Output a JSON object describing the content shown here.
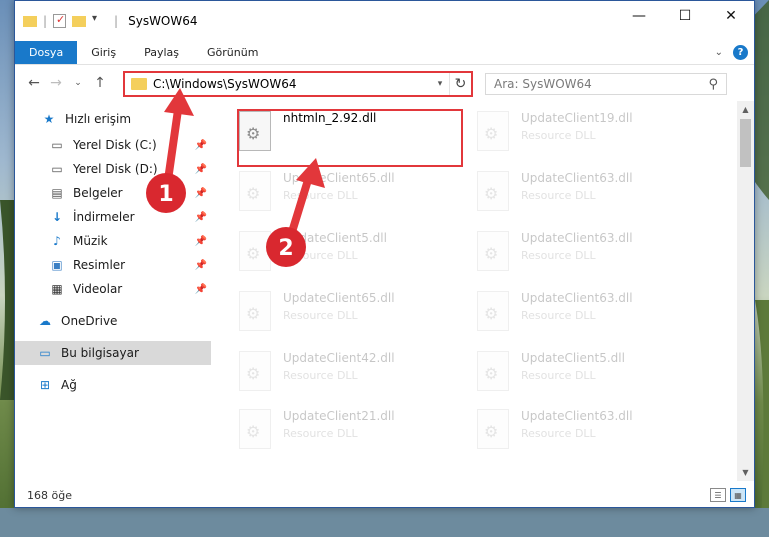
{
  "window": {
    "title": "SysWOW64"
  },
  "ribbon": {
    "tabs": [
      "Dosya",
      "Giriş",
      "Paylaş",
      "Görünüm"
    ]
  },
  "address": {
    "path": "C:\\Windows\\SysWOW64"
  },
  "search": {
    "placeholder": "Ara: SysWOW64"
  },
  "sidebar": {
    "items": [
      {
        "label": "Hızlı erişim",
        "icon": "star-icon",
        "pinned": false
      },
      {
        "label": "Yerel Disk (C:)",
        "icon": "drive-icon",
        "pinned": true
      },
      {
        "label": "Yerel Disk (D:)",
        "icon": "drive-icon",
        "pinned": true
      },
      {
        "label": "Belgeler",
        "icon": "document-icon",
        "pinned": true
      },
      {
        "label": "İndirmeler",
        "icon": "download-icon",
        "pinned": true
      },
      {
        "label": "Müzik",
        "icon": "music-icon",
        "pinned": true
      },
      {
        "label": "Resimler",
        "icon": "picture-icon",
        "pinned": true
      },
      {
        "label": "Videolar",
        "icon": "video-icon",
        "pinned": true
      },
      {
        "label": "OneDrive",
        "icon": "cloud-icon",
        "pinned": false
      },
      {
        "label": "Bu bilgisayar",
        "icon": "computer-icon",
        "pinned": false
      },
      {
        "label": "Ağ",
        "icon": "network-icon",
        "pinned": false
      }
    ]
  },
  "files": {
    "highlighted": {
      "name": "nhtmln_2.92.dll",
      "type": ""
    },
    "left_column": [
      {
        "name": "UpdateClient65.dll",
        "type": "Resource DLL"
      },
      {
        "name": "UpdateClient5.dll",
        "type": "Resource DLL"
      },
      {
        "name": "UpdateClient65.dll",
        "type": "Resource DLL"
      },
      {
        "name": "UpdateClient42.dll",
        "type": "Resource DLL"
      },
      {
        "name": "UpdateClient21.dll",
        "type": "Resource DLL"
      }
    ],
    "right_column": [
      {
        "name": "UpdateClient19.dll",
        "type": "Resource DLL"
      },
      {
        "name": "UpdateClient63.dll",
        "type": "Resource DLL"
      },
      {
        "name": "UpdateClient63.dll",
        "type": "Resource DLL"
      },
      {
        "name": "UpdateClient63.dll",
        "type": "Resource DLL"
      },
      {
        "name": "UpdateClient5.dll",
        "type": "Resource DLL"
      },
      {
        "name": "UpdateClient63.dll",
        "type": "Resource DLL"
      }
    ]
  },
  "status": {
    "count": "168 öğe"
  },
  "annotations": {
    "step1": "1",
    "step2": "2",
    "highlight_color": "#e2373b",
    "badge_color": "#d9282f"
  },
  "colors": {
    "accent": "#1979ca"
  }
}
